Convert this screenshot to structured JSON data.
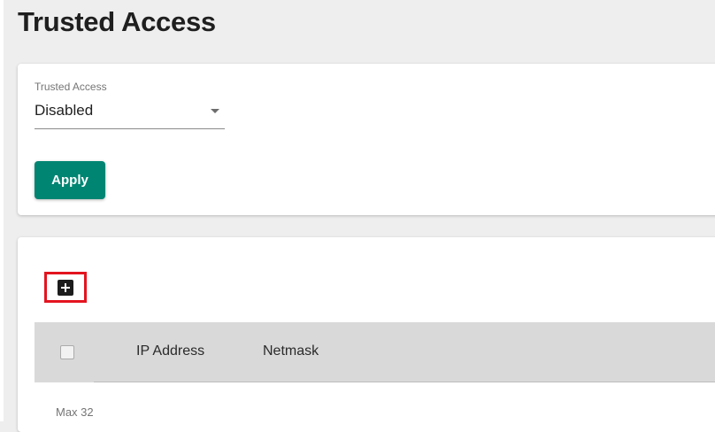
{
  "page": {
    "title": "Trusted Access"
  },
  "settings": {
    "trusted_access_label": "Trusted Access",
    "trusted_access_value": "Disabled",
    "apply_label": "Apply"
  },
  "table": {
    "columns": [
      "IP Address",
      "Netmask"
    ],
    "max_text": "Max 32",
    "add_icon": "plus-box-icon"
  },
  "colors": {
    "primary": "#008573",
    "highlight": "#e3141f",
    "header_bg": "#d9d9d9",
    "page_bg": "#eeeeee"
  }
}
